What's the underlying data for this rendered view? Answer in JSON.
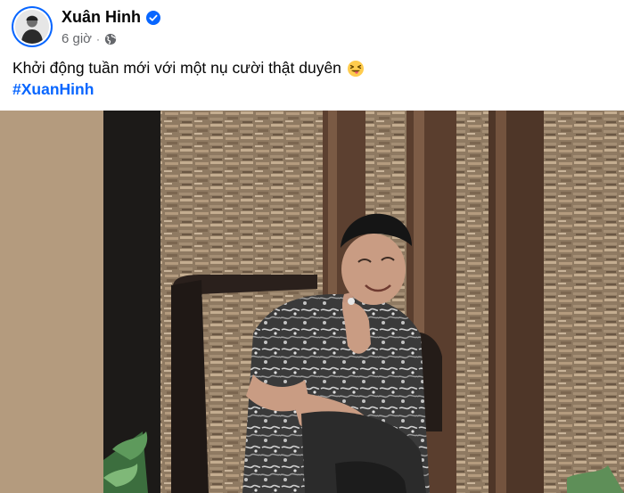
{
  "post": {
    "author": {
      "name": "Xuân Hinh",
      "verified": true,
      "verified_icon": "verified-badge-icon",
      "avatar_icon": "profile-avatar"
    },
    "time": "6 giờ",
    "separator": "·",
    "audience_icon": "globe-icon",
    "caption": "Khởi động tuần mới với một nụ cười thật duyên",
    "caption_emoji": "squinting-face-with-tongue-icon",
    "hashtag": "#XuanHinh",
    "colors": {
      "link_blue": "#0866ff",
      "secondary_text": "#65676b",
      "photo_side_background": "#b49b7e"
    }
  }
}
